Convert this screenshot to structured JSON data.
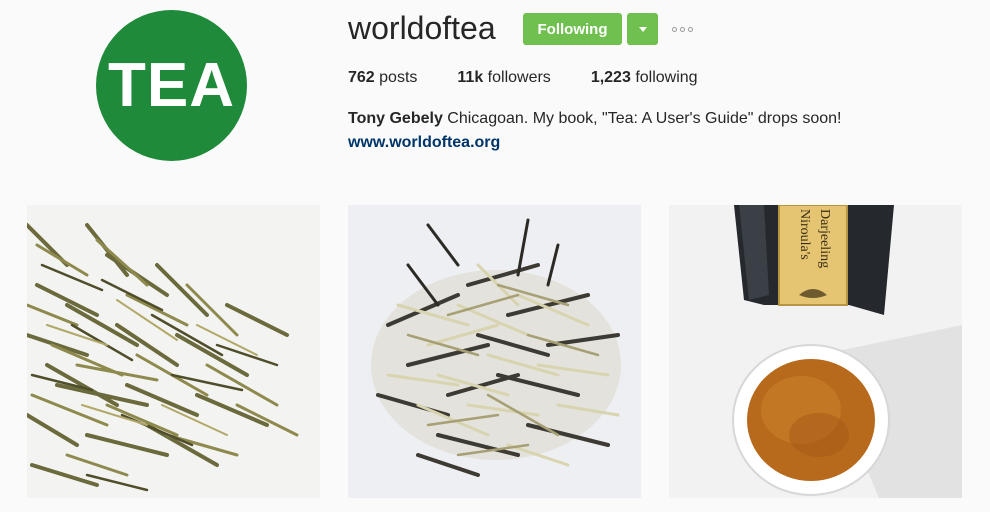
{
  "profile": {
    "avatar_text": "TEA",
    "avatar_color": "#1f8a3a",
    "username": "worldoftea",
    "follow_label": "Following",
    "button_color": "#70c050",
    "stats": {
      "posts_count": "762",
      "posts_label": "posts",
      "followers_count": "11k",
      "followers_label": "followers",
      "following_count": "1,223",
      "following_label": "following"
    },
    "bio_name": "Tony Gebely",
    "bio_text": "Chicagoan. My book, \"Tea: A User's Guide\" drops soon!",
    "website": "www.worldoftea.org"
  },
  "posts": [
    {
      "subject": "green-tea-leaves"
    },
    {
      "subject": "white-tea-leaves"
    },
    {
      "subject": "darjeeling-bag-and-cup",
      "bag_label_line1": "Niroula's",
      "bag_label_line2": "Darjeeling"
    }
  ],
  "icons": {
    "dropdown": "chevron-down-icon",
    "more": "more-options-icon"
  }
}
